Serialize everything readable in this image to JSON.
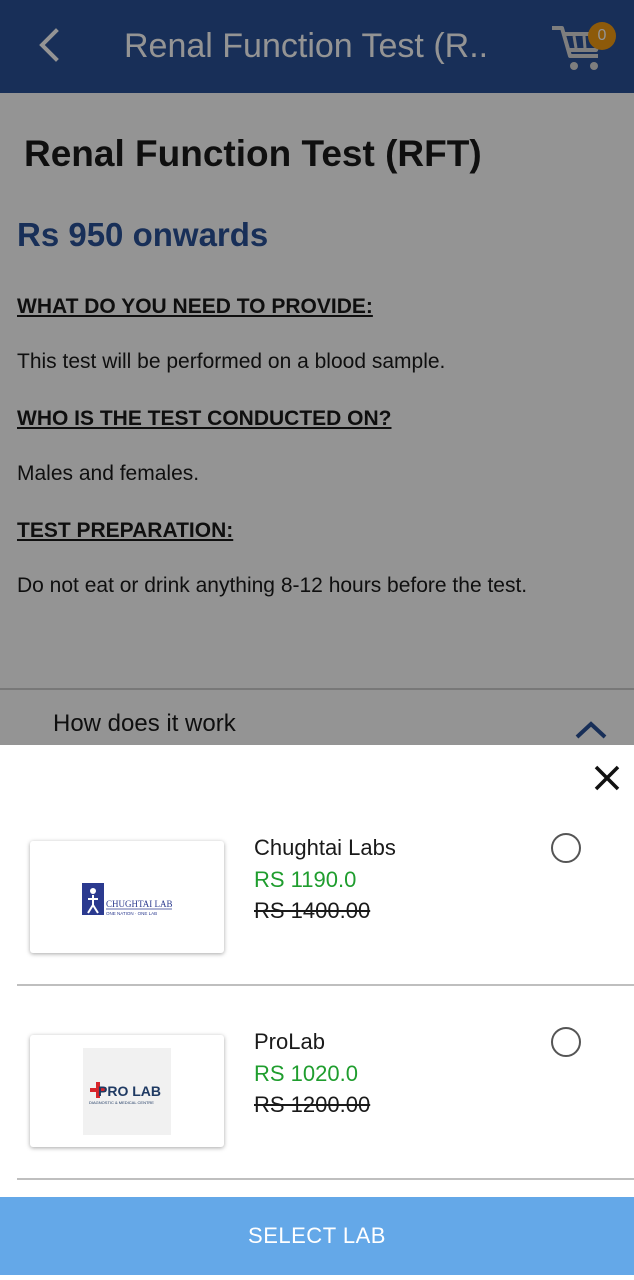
{
  "appbar": {
    "title": "Renal Function Test (R..",
    "cart_count": "0",
    "colors": {
      "background": "#2a5298",
      "badge": "#f39c12"
    }
  },
  "test": {
    "title": "Renal Function Test (RFT)",
    "price_from": "Rs 950 onwards",
    "sections": [
      {
        "heading": "WHAT DO YOU NEED TO PROVIDE:",
        "text": "This test will be performed on a blood sample."
      },
      {
        "heading": "WHO IS THE TEST CONDUCTED ON?",
        "text": "Males and females."
      },
      {
        "heading": "TEST PREPARATION:",
        "text": "Do not eat or drink anything 8-12 hours before the test."
      }
    ],
    "how_it_works": "How does it work"
  },
  "labs": [
    {
      "name": "Chughtai Labs",
      "price": "RS 1190.0",
      "old_price": "RS 1400.00",
      "logo_text": "CHUGHTAI LAB",
      "logo_tagline": "ONE NATION · ONE LAB",
      "selected": false
    },
    {
      "name": "ProLab",
      "price": "RS 1020.0",
      "old_price": "RS 1200.00",
      "logo_text": "PRO LAB",
      "logo_tagline": "DIAGNOSTIC & MEDICAL CENTRE",
      "selected": false
    }
  ],
  "sheet": {
    "select_button": "SELECT LAB",
    "colors": {
      "price": "#1f9d2e",
      "select_button": "#64a8e8"
    }
  }
}
